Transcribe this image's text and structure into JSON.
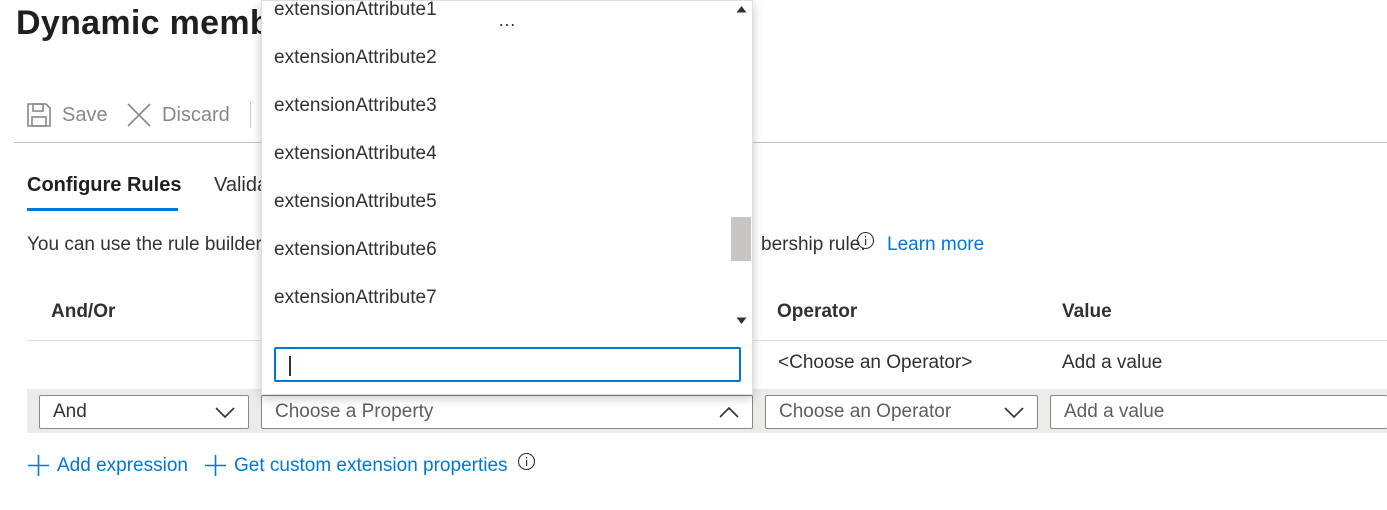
{
  "page": {
    "title": "Dynamic memb",
    "more_label": "…"
  },
  "toolbar": {
    "save_label": "Save",
    "discard_label": "Discard"
  },
  "tabs": [
    {
      "label": "Configure Rules",
      "selected": true
    },
    {
      "label": "Valida",
      "selected": false
    }
  ],
  "description": {
    "text_left": "You can use the rule builder",
    "text_right": "bership rule.",
    "learn_more": "Learn more"
  },
  "table": {
    "headers": [
      "And/Or",
      "Operator",
      "Value"
    ],
    "row": {
      "operator": "<Choose an Operator>",
      "value": "Add a value"
    }
  },
  "edit_row": {
    "andor_value": "And",
    "property_placeholder": "Choose a Property",
    "operator_placeholder": "Choose an Operator",
    "value_placeholder": "Add a value"
  },
  "actions": {
    "add_expression": "Add expression",
    "get_custom": "Get custom extension properties"
  },
  "dropdown": {
    "options": [
      "extensionAttribute1",
      "extensionAttribute2",
      "extensionAttribute3",
      "extensionAttribute4",
      "extensionAttribute5",
      "extensionAttribute6",
      "extensionAttribute7"
    ],
    "search_value": ""
  },
  "colors": {
    "accent": "#0078d4",
    "text": "#323130",
    "row_bg": "#edebe9",
    "border": "#8a8886"
  }
}
